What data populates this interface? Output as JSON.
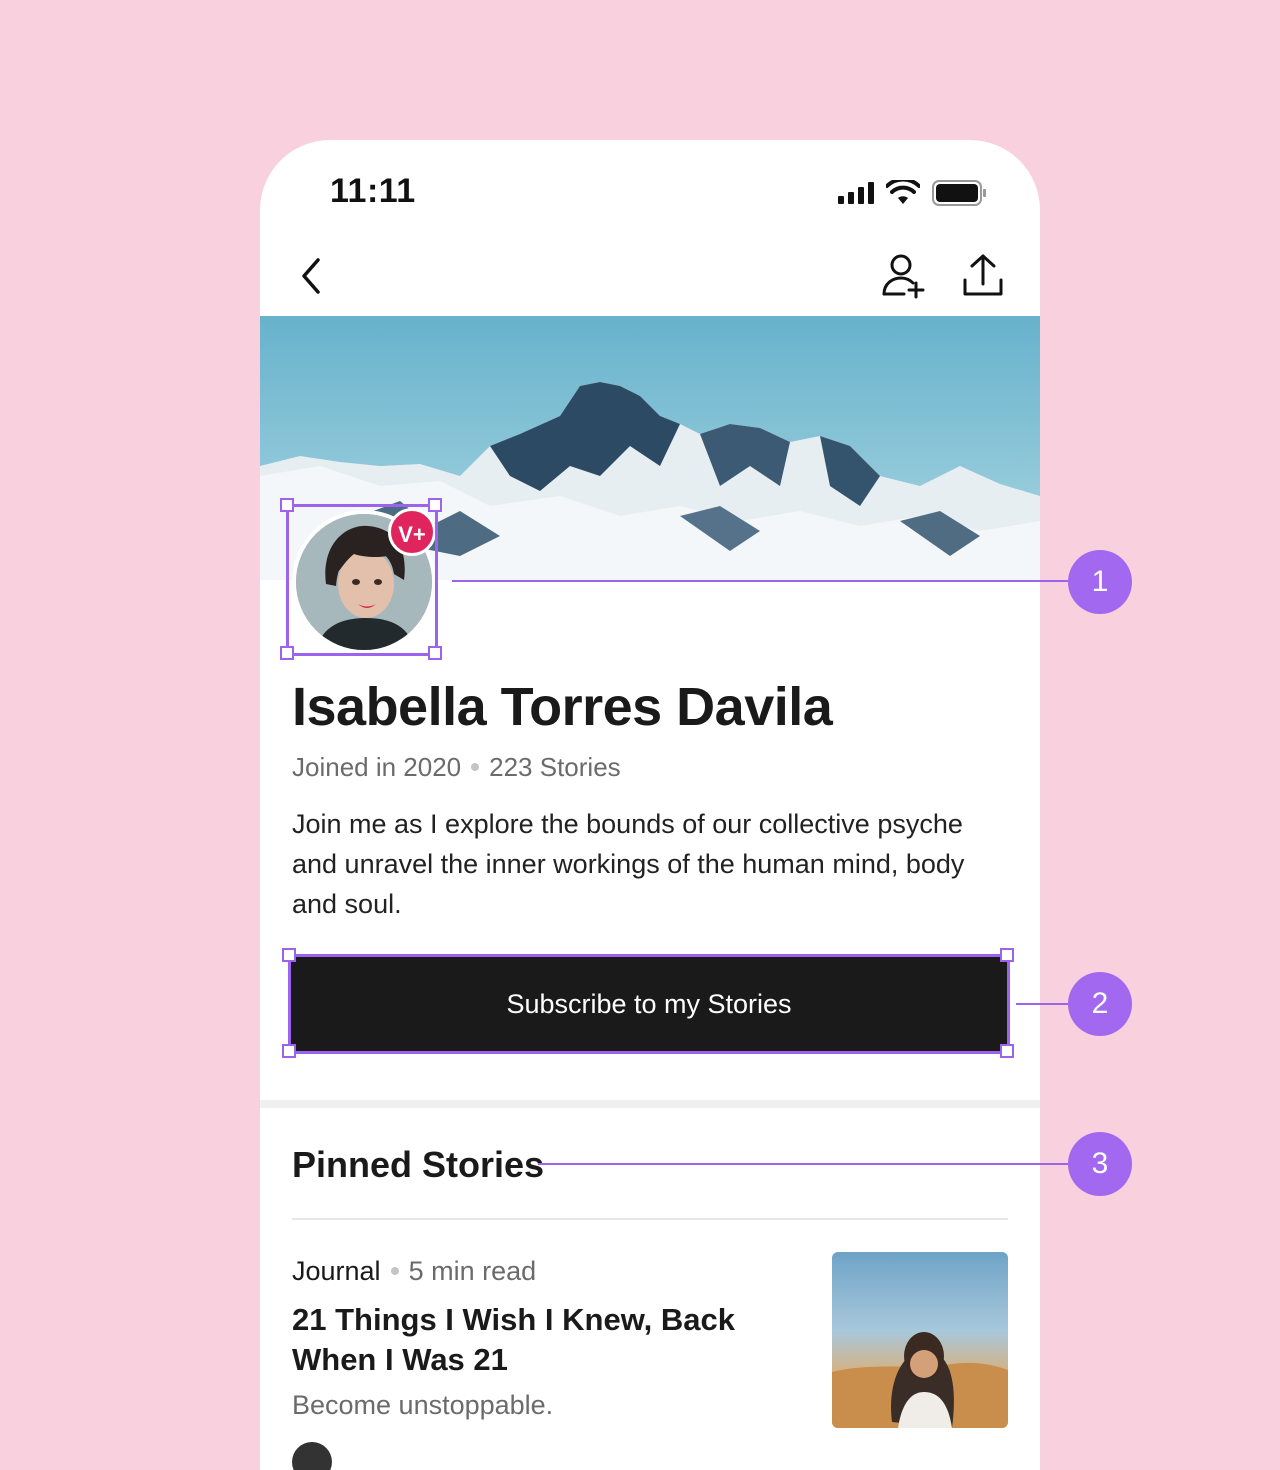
{
  "status_bar": {
    "time": "11:11"
  },
  "icons": {
    "back": "chevron-left-icon",
    "follow": "add-user-icon",
    "share": "share-upload-icon",
    "signal": "cellular-signal-icon",
    "wifi": "wifi-icon",
    "battery": "battery-icon"
  },
  "profile": {
    "badge": "V+",
    "name": "Isabella Torres Davila",
    "joined": "Joined in 2020",
    "stories_count": "223 Stories",
    "bio": "Join me as I explore the bounds of our collective psyche and unravel the inner workings of the human mind, body and soul.",
    "subscribe_label": "Subscribe to my Stories"
  },
  "pinned": {
    "title": "Pinned Stories",
    "stories": [
      {
        "publication": "Journal",
        "read_time": "5 min read",
        "title": "21 Things I Wish I Knew, Back When I Was 21",
        "subtitle": "Become unstoppable."
      }
    ]
  },
  "annotations": {
    "one": "1",
    "two": "2",
    "three": "3"
  },
  "colors": {
    "background": "#f9d0dd",
    "accent": "#9c63ec",
    "badge": "#e0245e",
    "button": "#1a1a1a"
  }
}
